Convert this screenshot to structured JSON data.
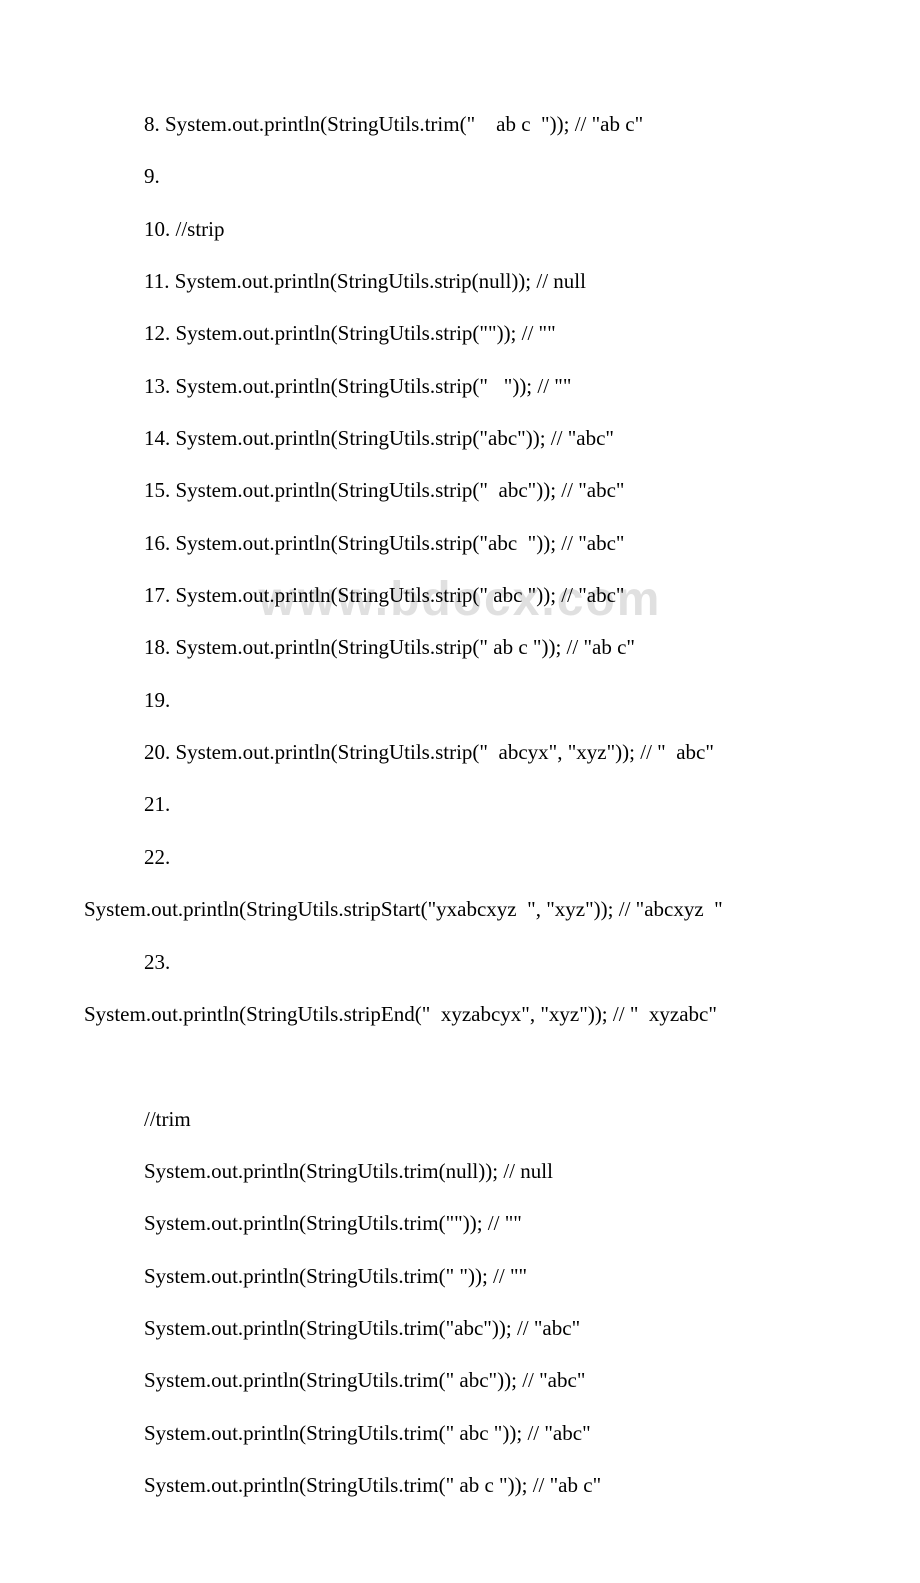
{
  "watermark": "www.bdocx.com",
  "lines": [
    {
      "cls": "indent",
      "text": "8. System.out.println(StringUtils.trim(\"    ab c  \")); // \"ab c\""
    },
    {
      "cls": "indent",
      "text": "9."
    },
    {
      "cls": "indent",
      "text": "10. //strip"
    },
    {
      "cls": "indent",
      "text": "11. System.out.println(StringUtils.strip(null)); // null"
    },
    {
      "cls": "indent",
      "text": "12. System.out.println(StringUtils.strip(\"\")); // \"\""
    },
    {
      "cls": "indent",
      "text": "13. System.out.println(StringUtils.strip(\"   \")); // \"\""
    },
    {
      "cls": "indent",
      "text": "14. System.out.println(StringUtils.strip(\"abc\")); // \"abc\""
    },
    {
      "cls": "indent",
      "text": "15. System.out.println(StringUtils.strip(\"  abc\")); // \"abc\""
    },
    {
      "cls": "indent",
      "text": "16. System.out.println(StringUtils.strip(\"abc  \")); // \"abc\""
    },
    {
      "cls": "indent",
      "text": "17. System.out.println(StringUtils.strip(\" abc \")); // \"abc\""
    },
    {
      "cls": "indent",
      "text": "18. System.out.println(StringUtils.strip(\" ab c \")); // \"ab c\""
    },
    {
      "cls": "indent",
      "text": "19."
    },
    {
      "cls": "indent",
      "text": "20. System.out.println(StringUtils.strip(\"  abcyx\", \"xyz\")); // \"  abc\""
    },
    {
      "cls": "indent",
      "text": "21."
    },
    {
      "cls": "indent",
      "text": "22."
    },
    {
      "cls": "noindent",
      "text": "System.out.println(StringUtils.stripStart(\"yxabcxyz  \", \"xyz\")); // \"abcxyz  \""
    },
    {
      "cls": "indent",
      "text": "23."
    },
    {
      "cls": "noindent",
      "text": "System.out.println(StringUtils.stripEnd(\"  xyzabcyx\", \"xyz\")); // \"  xyzabc\""
    },
    {
      "cls": "noindent",
      "text": " "
    },
    {
      "cls": "indent",
      "text": "//trim"
    },
    {
      "cls": "indent",
      "text": "System.out.println(StringUtils.trim(null)); // null"
    },
    {
      "cls": "indent",
      "text": "System.out.println(StringUtils.trim(\"\")); // \"\""
    },
    {
      "cls": "indent",
      "text": "System.out.println(StringUtils.trim(\" \")); // \"\""
    },
    {
      "cls": "indent",
      "text": "System.out.println(StringUtils.trim(\"abc\")); // \"abc\""
    },
    {
      "cls": "indent",
      "text": "System.out.println(StringUtils.trim(\" abc\")); // \"abc\""
    },
    {
      "cls": "indent",
      "text": "System.out.println(StringUtils.trim(\" abc \")); // \"abc\""
    },
    {
      "cls": "indent",
      "text": "System.out.println(StringUtils.trim(\" ab c \")); // \"ab c\""
    }
  ]
}
